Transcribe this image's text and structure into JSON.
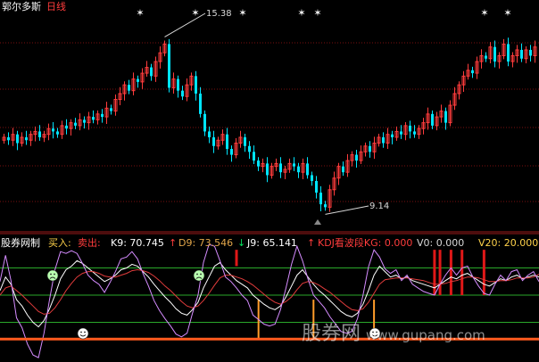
{
  "top_panel": {
    "title": "郭尔多斯",
    "period": "日线",
    "high_label": "15.38",
    "low_label": "9.14"
  },
  "indicator_panel": {
    "name": "股券网制",
    "buy_label": "买入:",
    "sell_label": "卖出:",
    "k_text": "K9: 70.745",
    "k_arrow": "↑",
    "d_text": "D9: 73.546",
    "d_arrow": "↓",
    "j_text": "J9: 65.141",
    "j_arrow": "↑",
    "kdj_text": "KDJ看波段KG: 0.000",
    "v0_text": "V0: 0.000",
    "v20_text": "V20: 20.000"
  },
  "watermark": {
    "brand": "股券网",
    "url": "www.gupang.com"
  },
  "colors": {
    "up": "#ff3c3c",
    "down": "#00e5ff",
    "grid": "#7a1010",
    "k_line": "#ffffff",
    "d_line": "#e23c3c",
    "j_line": "#d58cff",
    "level_line": "#2aa82a",
    "signal_bar": "#e01818",
    "buy_bar": "#ff9c2a",
    "bottom_band": "#ff5a1e"
  },
  "chart_data": [
    {
      "type": "candlestick",
      "title": "郭尔多斯 日线",
      "ylim": [
        8.8,
        15.9
      ],
      "high": 15.38,
      "low": 9.14,
      "closes": [
        11.8,
        11.7,
        11.9,
        11.6,
        11.8,
        11.7,
        11.9,
        12.0,
        11.8,
        11.9,
        12.1,
        12.0,
        11.9,
        12.2,
        12.1,
        12.3,
        12.2,
        12.4,
        12.3,
        12.5,
        12.4,
        12.6,
        12.5,
        12.8,
        12.7,
        13.1,
        13.3,
        13.6,
        13.4,
        13.8,
        13.7,
        14.0,
        14.2,
        13.9,
        14.4,
        14.7,
        15.0,
        13.5,
        13.8,
        13.4,
        13.2,
        13.6,
        13.9,
        13.3,
        12.6,
        12.0,
        11.8,
        11.5,
        11.7,
        11.9,
        11.4,
        11.2,
        11.6,
        11.8,
        11.5,
        11.3,
        11.0,
        10.8,
        10.9,
        10.5,
        10.8,
        10.9,
        10.6,
        10.7,
        10.9,
        10.8,
        10.6,
        10.9,
        10.5,
        10.3,
        9.9,
        9.5,
        9.4,
        10.0,
        10.4,
        10.8,
        10.6,
        11.0,
        11.2,
        11.0,
        11.3,
        11.5,
        11.3,
        11.6,
        11.8,
        11.6,
        11.9,
        11.8,
        12.0,
        11.9,
        12.2,
        12.0,
        11.9,
        12.1,
        12.3,
        12.6,
        12.2,
        12.5,
        12.7,
        12.3,
        12.9,
        13.3,
        13.6,
        13.9,
        14.1,
        14.0,
        14.4,
        14.6,
        14.5,
        14.9,
        14.4,
        14.6,
        15.0,
        14.4,
        14.6,
        14.8,
        14.5,
        14.8,
        14.6,
        14.9
      ],
      "markers": [
        "*",
        "*",
        "*",
        "*",
        "*",
        "*"
      ]
    },
    {
      "type": "line",
      "title": "股券网制",
      "ylim": [
        -10,
        110
      ],
      "levels": [
        80,
        50,
        20
      ],
      "series": [
        {
          "name": "K9",
          "values": [
            55,
            70,
            62,
            45,
            38,
            28,
            20,
            15,
            22,
            35,
            50,
            68,
            78,
            82,
            88,
            85,
            80,
            75,
            70,
            65,
            68,
            72,
            78,
            80,
            84,
            82,
            76,
            70,
            62,
            55,
            48,
            42,
            35,
            30,
            28,
            34,
            42,
            58,
            70,
            82,
            86,
            78,
            72,
            66,
            62,
            58,
            50,
            45,
            40,
            36,
            34,
            38,
            48,
            60,
            72,
            78,
            70,
            62,
            55,
            50,
            44,
            38,
            32,
            28,
            26,
            30,
            40,
            55,
            72,
            82,
            76,
            70,
            72,
            68,
            70,
            66,
            64,
            62,
            60,
            58,
            62,
            66,
            70,
            68,
            72,
            74,
            70,
            66,
            62,
            60,
            64,
            68,
            66,
            70,
            72,
            68,
            70,
            72,
            70
          ]
        },
        {
          "name": "D9",
          "values": [
            50,
            58,
            60,
            55,
            50,
            44,
            38,
            32,
            29,
            30,
            36,
            45,
            55,
            63,
            70,
            74,
            76,
            76,
            74,
            71,
            70,
            70,
            72,
            74,
            77,
            78,
            77,
            75,
            71,
            66,
            60,
            55,
            49,
            43,
            38,
            36,
            38,
            44,
            52,
            61,
            69,
            72,
            72,
            70,
            68,
            65,
            61,
            56,
            51,
            46,
            42,
            40,
            43,
            48,
            56,
            63,
            65,
            64,
            61,
            57,
            53,
            48,
            43,
            38,
            34,
            33,
            35,
            42,
            52,
            62,
            67,
            68,
            69,
            69,
            69,
            68,
            67,
            66,
            64,
            62,
            62,
            63,
            65,
            66,
            68,
            70,
            70,
            69,
            67,
            65,
            65,
            66,
            66,
            67,
            69,
            69,
            69,
            70,
            73
          ]
        },
        {
          "name": "J9",
          "values": [
            65,
            94,
            66,
            25,
            14,
            -4,
            -16,
            -19,
            8,
            45,
            78,
            98,
            96,
            99,
            96,
            85,
            72,
            66,
            62,
            53,
            64,
            76,
            90,
            92,
            98,
            90,
            74,
            60,
            44,
            33,
            24,
            16,
            7,
            4,
            8,
            30,
            50,
            86,
            106,
            104,
            88,
            70,
            65,
            58,
            50,
            44,
            28,
            23,
            18,
            16,
            18,
            34,
            58,
            84,
            104,
            88,
            68,
            50,
            43,
            36,
            26,
            18,
            10,
            8,
            10,
            24,
            50,
            81,
            100,
            92,
            79,
            74,
            78,
            66,
            72,
            62,
            58,
            54,
            52,
            50,
            62,
            72,
            80,
            72,
            80,
            82,
            70,
            60,
            52,
            50,
            62,
            72,
            66,
            76,
            78,
            66,
            72,
            76,
            65
          ]
        }
      ]
    }
  ]
}
